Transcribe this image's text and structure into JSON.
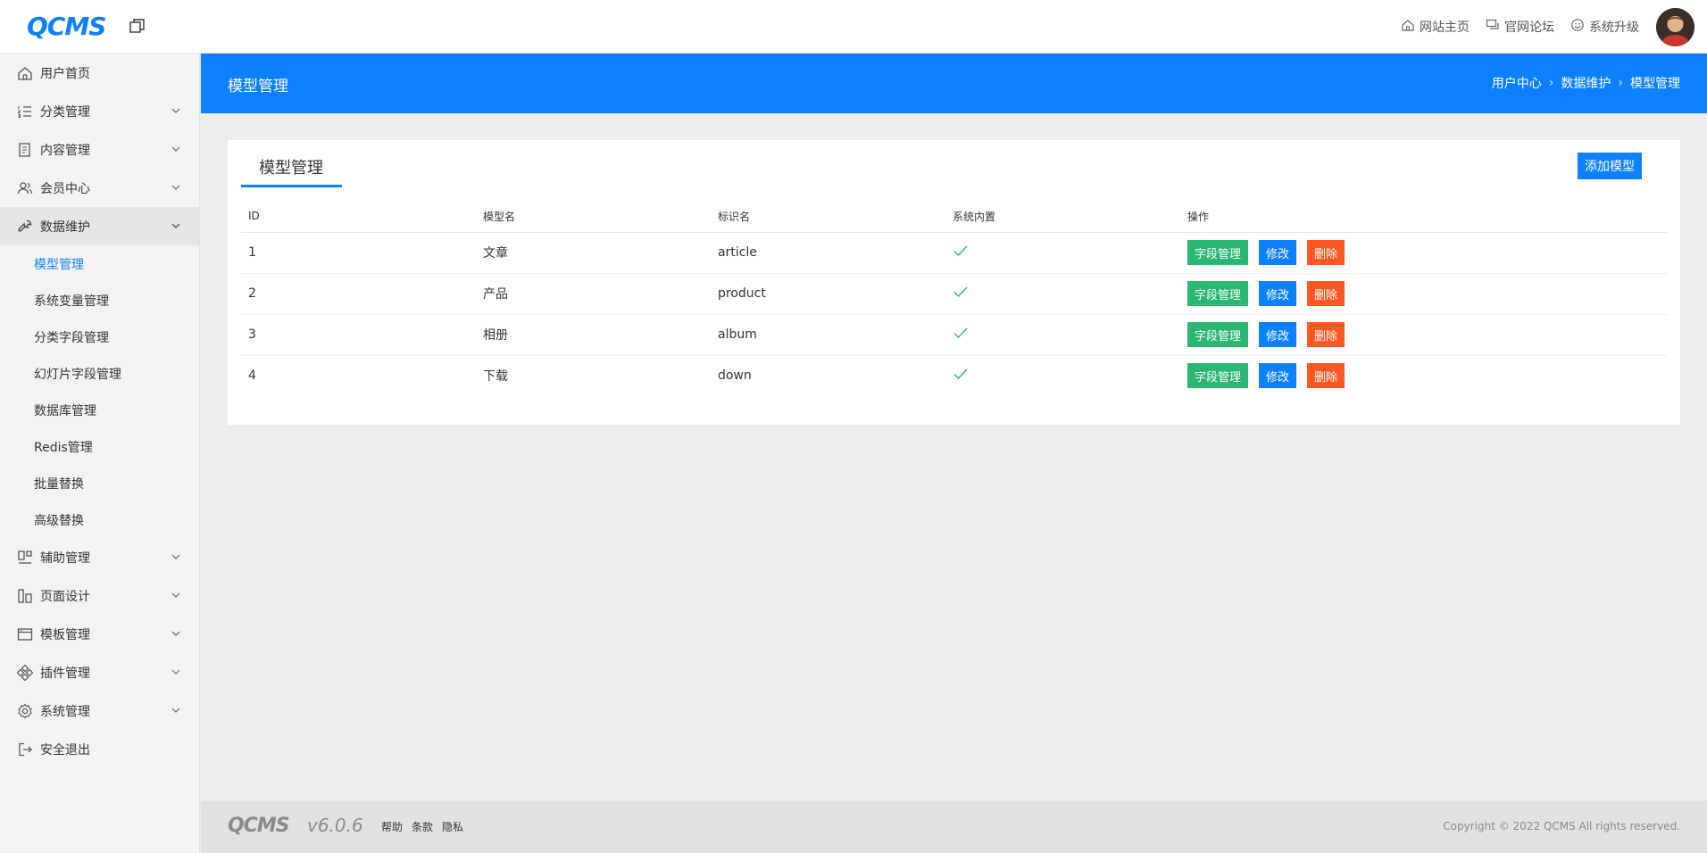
{
  "app": {
    "logo": "QCMS"
  },
  "header": {
    "links": [
      {
        "label": "网站主页",
        "icon": "home-icon"
      },
      {
        "label": "官网论坛",
        "icon": "forum-icon"
      },
      {
        "label": "系统升级",
        "icon": "smile-icon"
      }
    ]
  },
  "sidebar": {
    "items": [
      {
        "label": "用户首页"
      },
      {
        "label": "分类管理"
      },
      {
        "label": "内容管理"
      },
      {
        "label": "会员中心"
      },
      {
        "label": "数据维护"
      },
      {
        "label": "辅助管理"
      },
      {
        "label": "页面设计"
      },
      {
        "label": "模板管理"
      },
      {
        "label": "插件管理"
      },
      {
        "label": "系统管理"
      },
      {
        "label": "安全退出"
      }
    ],
    "subitems": [
      {
        "label": "模型管理",
        "active": true
      },
      {
        "label": "系统变量管理"
      },
      {
        "label": "分类字段管理"
      },
      {
        "label": "幻灯片字段管理"
      },
      {
        "label": "数据库管理"
      },
      {
        "label": "Redis管理"
      },
      {
        "label": "批量替换"
      },
      {
        "label": "高级替换"
      }
    ]
  },
  "page": {
    "title": "模型管理",
    "breadcrumb": [
      "用户中心",
      "数据维护",
      "模型管理"
    ]
  },
  "card": {
    "tab": "模型管理",
    "add_button": "添加模型",
    "columns": [
      "ID",
      "模型名",
      "标识名",
      "系统内置",
      "操作"
    ],
    "rows": [
      {
        "id": "1",
        "name": "文章",
        "key": "article",
        "builtin": true
      },
      {
        "id": "2",
        "name": "产品",
        "key": "product",
        "builtin": true
      },
      {
        "id": "3",
        "name": "相册",
        "key": "album",
        "builtin": true
      },
      {
        "id": "4",
        "name": "下载",
        "key": "down",
        "builtin": true
      }
    ],
    "actions": {
      "fields": "字段管理",
      "edit": "修改",
      "delete": "删除"
    }
  },
  "footer": {
    "logo": "QCMS",
    "version": "v6.0.6",
    "links": [
      "帮助",
      "条款",
      "隐私"
    ],
    "copyright": "Copyright © 2022 QCMS All rights reserved."
  },
  "colors": {
    "primary": "#0d80ff",
    "success": "#2bb673",
    "danger": "#ff5722"
  }
}
